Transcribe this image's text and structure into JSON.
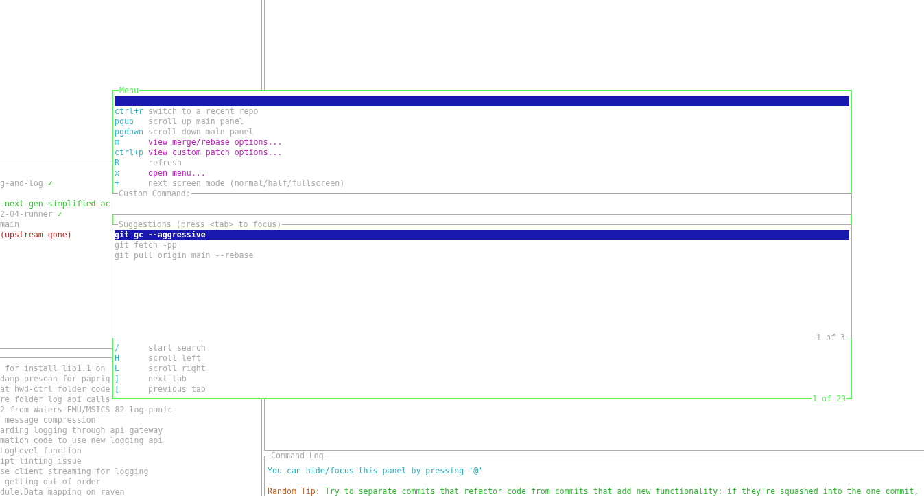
{
  "branches": [
    {
      "name": "g-and-log",
      "current": false,
      "status": {
        "text": "✓",
        "kind": "ok"
      }
    },
    {
      "name": "-next-gen-simplified-ac",
      "current": true
    },
    {
      "name": "2-04-runner",
      "current": false,
      "status": {
        "text": "✓",
        "kind": "ok"
      }
    },
    {
      "name": "main",
      "current": false
    },
    {
      "name": "(upstream gone)",
      "current": false,
      "kind": "gone"
    }
  ],
  "commits": [
    " for install lib1.1 on",
    "damp prescan for paprig",
    "at hwd-ctrl folder code",
    "re folder log api calls",
    "2 from Waters-EMU/MSICS-82-log-panic",
    " message compression",
    "arding logging through api gateway",
    "mation code to use new logging api",
    "LogLevel function",
    "ipt linting issue",
    "se client streaming for logging",
    " getting out of order",
    "dule.Data mapping on raven"
  ],
  "command_log": {
    "title": "Command Log",
    "message": "You can hide/focus this panel by pressing '@'",
    "tip_label": "Random Tip:",
    "tip": "Try to separate commits that refactor code from commits that add new functionality: if they're squashed into the one commit,"
  },
  "menu": {
    "title": "Menu",
    "footer": "1 of 29",
    "items": [
      {
        "selected": true
      },
      {
        "key": "ctrl+r",
        "description": "switch to a recent repo",
        "opens_menu": false,
        "selected": false
      },
      {
        "key": "pgup",
        "description": "scroll up main panel",
        "opens_menu": false,
        "selected": false
      },
      {
        "key": "pgdown",
        "description": "scroll down main panel",
        "opens_menu": false,
        "selected": false
      },
      {
        "key": "m",
        "description": "view merge/rebase options...",
        "opens_menu": true,
        "selected": false
      },
      {
        "key": "ctrl+p",
        "description": "view custom patch options...",
        "opens_menu": true,
        "selected": false
      },
      {
        "key": "R",
        "description": "refresh",
        "opens_menu": false,
        "selected": false
      },
      {
        "key": "x",
        "description": "open menu...",
        "opens_menu": true,
        "selected": false
      },
      {
        "key": "+",
        "description": "next screen mode (normal/half/fullscreen)",
        "opens_menu": false,
        "selected": false
      }
    ],
    "lower_items": [
      {
        "key": "/",
        "description": "start search",
        "opens_menu": false,
        "selected": false
      },
      {
        "key": "H",
        "description": "scroll left",
        "opens_menu": false,
        "selected": false
      },
      {
        "key": "L",
        "description": "scroll right",
        "opens_menu": false,
        "selected": false
      },
      {
        "key": "]",
        "description": "next tab",
        "opens_menu": false,
        "selected": false
      },
      {
        "key": "[",
        "description": "previous tab",
        "opens_menu": false,
        "selected": false
      }
    ]
  },
  "custom_command": {
    "title": "Custom Command:"
  },
  "suggestions": {
    "title": "Suggestions (press <tab> to focus)",
    "footer": "1 of 3",
    "items": [
      {
        "text": "git gc --aggressive",
        "selected": true
      },
      {
        "text": "git fetch -pp",
        "selected": false
      },
      {
        "text": "git pull origin main --rebase",
        "selected": false
      }
    ]
  }
}
